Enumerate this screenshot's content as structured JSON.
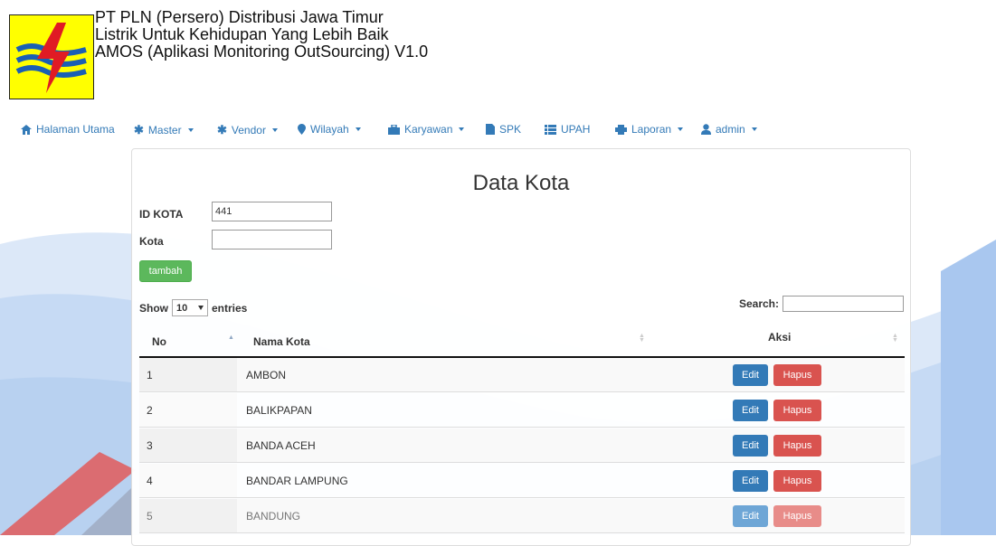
{
  "header": {
    "lines": [
      "PT PLN (Persero) Distribusi Jawa Timur",
      "Listrik Untuk Kehidupan Yang Lebih Baik",
      "AMOS (Aplikasi Monitoring OutSourcing) V1.0"
    ]
  },
  "nav": {
    "items": [
      {
        "label": "Halaman Utama",
        "icon": "home-icon"
      },
      {
        "label": "Master",
        "icon": "asterisk-icon",
        "dropdown": true
      },
      {
        "label": "Vendor",
        "icon": "asterisk-icon",
        "dropdown": true
      },
      {
        "label": "Wilayah",
        "icon": "map-marker-icon",
        "dropdown": true
      },
      {
        "label": "Karyawan",
        "icon": "briefcase-icon",
        "dropdown": true
      },
      {
        "label": "SPK",
        "icon": "file-icon"
      },
      {
        "label": "UPAH",
        "icon": "list-icon"
      },
      {
        "label": "Laporan",
        "icon": "print-icon",
        "dropdown": true
      },
      {
        "label": "admin",
        "icon": "user-icon",
        "dropdown": true
      }
    ]
  },
  "page": {
    "title": "Data Kota",
    "form": {
      "id_label": "ID KOTA",
      "id_value": "441",
      "kota_label": "Kota",
      "kota_value": "",
      "add_button": "tambah"
    },
    "table_controls": {
      "show_label": "Show",
      "entries_value": "10",
      "entries_label": "entries",
      "search_label": "Search:",
      "search_value": ""
    },
    "table": {
      "headers": [
        "No",
        "Nama Kota",
        "Aksi"
      ],
      "edit_label": "Edit",
      "delete_label": "Hapus",
      "rows": [
        {
          "no": "1",
          "kota": "AMBON"
        },
        {
          "no": "2",
          "kota": "BALIKPAPAN"
        },
        {
          "no": "3",
          "kota": "BANDA ACEH"
        },
        {
          "no": "4",
          "kota": "BANDAR LAMPUNG"
        },
        {
          "no": "5",
          "kota": "BANDUNG"
        }
      ]
    }
  },
  "colors": {
    "link": "#337ab7",
    "success": "#5cb85c",
    "primary": "#337ab7",
    "danger": "#d9534f",
    "logo_bg": "#ffff00",
    "background_wave": "#b8d1f0"
  }
}
